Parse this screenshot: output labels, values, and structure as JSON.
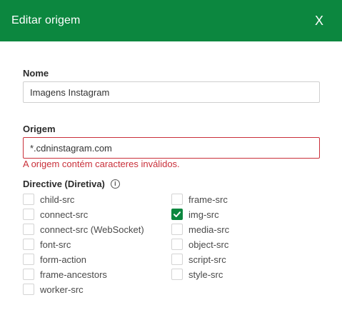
{
  "dialog": {
    "title": "Editar origem",
    "close_label": "X"
  },
  "form": {
    "name": {
      "label": "Nome",
      "value": "Imagens Instagram"
    },
    "origin": {
      "label": "Origem",
      "value": "*.cdninstagram.com",
      "error": "A origem contém caracteres inválidos."
    },
    "directive": {
      "label": "Directive (Diretiva)",
      "left": [
        {
          "label": "child-src",
          "checked": false
        },
        {
          "label": "connect-src",
          "checked": false
        },
        {
          "label": "connect-src (WebSocket)",
          "checked": false
        },
        {
          "label": "font-src",
          "checked": false
        },
        {
          "label": "form-action",
          "checked": false
        },
        {
          "label": "frame-ancestors",
          "checked": false
        },
        {
          "label": "worker-src",
          "checked": false
        }
      ],
      "right": [
        {
          "label": "frame-src",
          "checked": false
        },
        {
          "label": "img-src",
          "checked": true
        },
        {
          "label": "media-src",
          "checked": false
        },
        {
          "label": "object-src",
          "checked": false
        },
        {
          "label": "script-src",
          "checked": false
        },
        {
          "label": "style-src",
          "checked": false
        }
      ]
    }
  },
  "colors": {
    "header": "#0c873f",
    "error": "#c9303a",
    "check": "#0c873f"
  },
  "icons": {
    "info": "info-icon",
    "check": "check-icon",
    "close": "close-icon"
  }
}
